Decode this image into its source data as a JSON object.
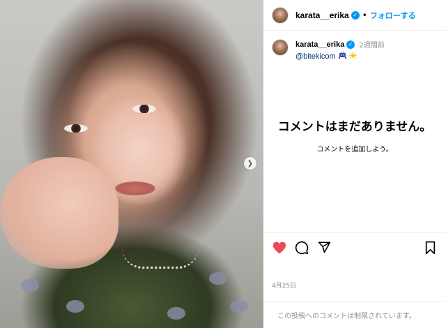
{
  "post": {
    "author": "karata__erika",
    "follow_label": "フォローする",
    "separator": "•"
  },
  "caption": {
    "author": "karata__erika",
    "time": "2週間前",
    "mention": "@bitekicom",
    "emojis": [
      "alien-monster-emoji",
      "sparkle-sun-emoji"
    ]
  },
  "comments": {
    "empty_title": "コメントはまだありません。",
    "empty_sub": "コメントを追加しよう。"
  },
  "actions": {
    "liked": true,
    "icons": [
      "heart-icon",
      "comment-icon",
      "share-icon",
      "bookmark-icon"
    ],
    "like_color": "#ed4956"
  },
  "date": "4月25日",
  "footer": {
    "restricted_text": "この投稿へのコメントは制限されています。"
  },
  "colors": {
    "accent": "#0095f6",
    "muted": "#8e8e8e"
  }
}
